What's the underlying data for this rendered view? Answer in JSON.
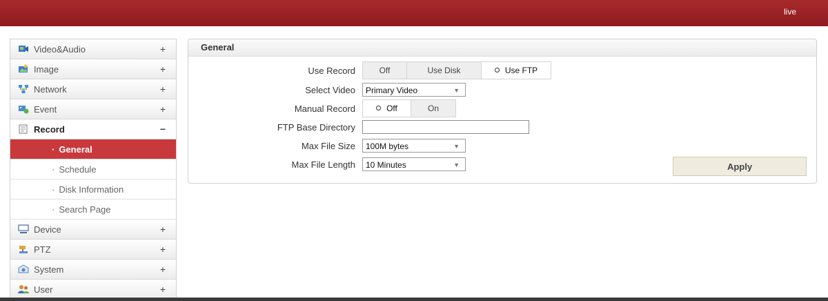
{
  "header": {
    "live_label": "live",
    "accent_color": "#9e2427"
  },
  "sidebar": {
    "items": [
      {
        "label": "Video&Audio",
        "toggle": "+",
        "icon": "video-audio-icon"
      },
      {
        "label": "Image",
        "toggle": "+",
        "icon": "image-icon"
      },
      {
        "label": "Network",
        "toggle": "+",
        "icon": "network-icon"
      },
      {
        "label": "Event",
        "toggle": "+",
        "icon": "event-icon"
      },
      {
        "label": "Record",
        "toggle": "−",
        "icon": "record-icon",
        "expanded": true,
        "subitems": [
          {
            "label": "General",
            "active": true
          },
          {
            "label": "Schedule"
          },
          {
            "label": "Disk Information"
          },
          {
            "label": "Search Page"
          }
        ]
      },
      {
        "label": "Device",
        "toggle": "+",
        "icon": "device-icon"
      },
      {
        "label": "PTZ",
        "toggle": "+",
        "icon": "ptz-icon"
      },
      {
        "label": "System",
        "toggle": "+",
        "icon": "system-icon"
      },
      {
        "label": "User",
        "toggle": "+",
        "icon": "user-icon"
      }
    ],
    "bullet": "·",
    "active_color": "#c9393c"
  },
  "panel": {
    "title": "General",
    "use_record": {
      "label": "Use Record",
      "options": [
        "Off",
        "Use Disk",
        "Use FTP"
      ],
      "selected": "Use FTP"
    },
    "select_video": {
      "label": "Select Video",
      "value": "Primary Video"
    },
    "manual_record": {
      "label": "Manual Record",
      "options": [
        "Off",
        "On"
      ],
      "selected": "Off"
    },
    "ftp_base_directory": {
      "label": "FTP Base Directory",
      "value": ""
    },
    "max_file_size": {
      "label": "Max File Size",
      "value": "100M bytes"
    },
    "max_file_length": {
      "label": "Max File Length",
      "value": "10 Minutes"
    },
    "apply_label": "Apply",
    "caret": "▼"
  }
}
